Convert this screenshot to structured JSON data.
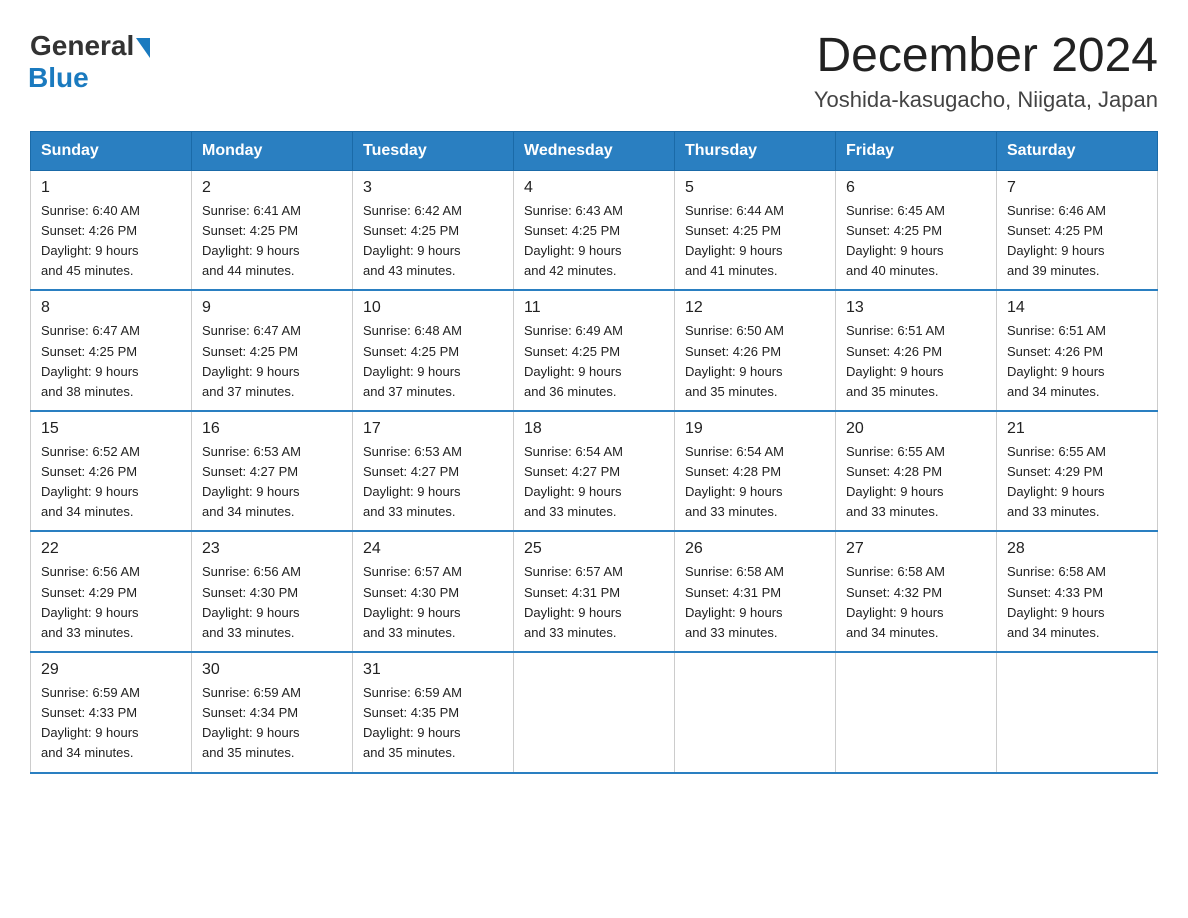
{
  "logo": {
    "general": "General",
    "blue": "Blue"
  },
  "title": "December 2024",
  "subtitle": "Yoshida-kasugacho, Niigata, Japan",
  "headers": [
    "Sunday",
    "Monday",
    "Tuesday",
    "Wednesday",
    "Thursday",
    "Friday",
    "Saturday"
  ],
  "weeks": [
    [
      {
        "day": "1",
        "sunrise": "6:40 AM",
        "sunset": "4:26 PM",
        "daylight": "9 hours and 45 minutes."
      },
      {
        "day": "2",
        "sunrise": "6:41 AM",
        "sunset": "4:25 PM",
        "daylight": "9 hours and 44 minutes."
      },
      {
        "day": "3",
        "sunrise": "6:42 AM",
        "sunset": "4:25 PM",
        "daylight": "9 hours and 43 minutes."
      },
      {
        "day": "4",
        "sunrise": "6:43 AM",
        "sunset": "4:25 PM",
        "daylight": "9 hours and 42 minutes."
      },
      {
        "day": "5",
        "sunrise": "6:44 AM",
        "sunset": "4:25 PM",
        "daylight": "9 hours and 41 minutes."
      },
      {
        "day": "6",
        "sunrise": "6:45 AM",
        "sunset": "4:25 PM",
        "daylight": "9 hours and 40 minutes."
      },
      {
        "day": "7",
        "sunrise": "6:46 AM",
        "sunset": "4:25 PM",
        "daylight": "9 hours and 39 minutes."
      }
    ],
    [
      {
        "day": "8",
        "sunrise": "6:47 AM",
        "sunset": "4:25 PM",
        "daylight": "9 hours and 38 minutes."
      },
      {
        "day": "9",
        "sunrise": "6:47 AM",
        "sunset": "4:25 PM",
        "daylight": "9 hours and 37 minutes."
      },
      {
        "day": "10",
        "sunrise": "6:48 AM",
        "sunset": "4:25 PM",
        "daylight": "9 hours and 37 minutes."
      },
      {
        "day": "11",
        "sunrise": "6:49 AM",
        "sunset": "4:25 PM",
        "daylight": "9 hours and 36 minutes."
      },
      {
        "day": "12",
        "sunrise": "6:50 AM",
        "sunset": "4:26 PM",
        "daylight": "9 hours and 35 minutes."
      },
      {
        "day": "13",
        "sunrise": "6:51 AM",
        "sunset": "4:26 PM",
        "daylight": "9 hours and 35 minutes."
      },
      {
        "day": "14",
        "sunrise": "6:51 AM",
        "sunset": "4:26 PM",
        "daylight": "9 hours and 34 minutes."
      }
    ],
    [
      {
        "day": "15",
        "sunrise": "6:52 AM",
        "sunset": "4:26 PM",
        "daylight": "9 hours and 34 minutes."
      },
      {
        "day": "16",
        "sunrise": "6:53 AM",
        "sunset": "4:27 PM",
        "daylight": "9 hours and 34 minutes."
      },
      {
        "day": "17",
        "sunrise": "6:53 AM",
        "sunset": "4:27 PM",
        "daylight": "9 hours and 33 minutes."
      },
      {
        "day": "18",
        "sunrise": "6:54 AM",
        "sunset": "4:27 PM",
        "daylight": "9 hours and 33 minutes."
      },
      {
        "day": "19",
        "sunrise": "6:54 AM",
        "sunset": "4:28 PM",
        "daylight": "9 hours and 33 minutes."
      },
      {
        "day": "20",
        "sunrise": "6:55 AM",
        "sunset": "4:28 PM",
        "daylight": "9 hours and 33 minutes."
      },
      {
        "day": "21",
        "sunrise": "6:55 AM",
        "sunset": "4:29 PM",
        "daylight": "9 hours and 33 minutes."
      }
    ],
    [
      {
        "day": "22",
        "sunrise": "6:56 AM",
        "sunset": "4:29 PM",
        "daylight": "9 hours and 33 minutes."
      },
      {
        "day": "23",
        "sunrise": "6:56 AM",
        "sunset": "4:30 PM",
        "daylight": "9 hours and 33 minutes."
      },
      {
        "day": "24",
        "sunrise": "6:57 AM",
        "sunset": "4:30 PM",
        "daylight": "9 hours and 33 minutes."
      },
      {
        "day": "25",
        "sunrise": "6:57 AM",
        "sunset": "4:31 PM",
        "daylight": "9 hours and 33 minutes."
      },
      {
        "day": "26",
        "sunrise": "6:58 AM",
        "sunset": "4:31 PM",
        "daylight": "9 hours and 33 minutes."
      },
      {
        "day": "27",
        "sunrise": "6:58 AM",
        "sunset": "4:32 PM",
        "daylight": "9 hours and 34 minutes."
      },
      {
        "day": "28",
        "sunrise": "6:58 AM",
        "sunset": "4:33 PM",
        "daylight": "9 hours and 34 minutes."
      }
    ],
    [
      {
        "day": "29",
        "sunrise": "6:59 AM",
        "sunset": "4:33 PM",
        "daylight": "9 hours and 34 minutes."
      },
      {
        "day": "30",
        "sunrise": "6:59 AM",
        "sunset": "4:34 PM",
        "daylight": "9 hours and 35 minutes."
      },
      {
        "day": "31",
        "sunrise": "6:59 AM",
        "sunset": "4:35 PM",
        "daylight": "9 hours and 35 minutes."
      },
      null,
      null,
      null,
      null
    ]
  ],
  "labels": {
    "sunrise": "Sunrise:",
    "sunset": "Sunset:",
    "daylight": "Daylight:"
  }
}
